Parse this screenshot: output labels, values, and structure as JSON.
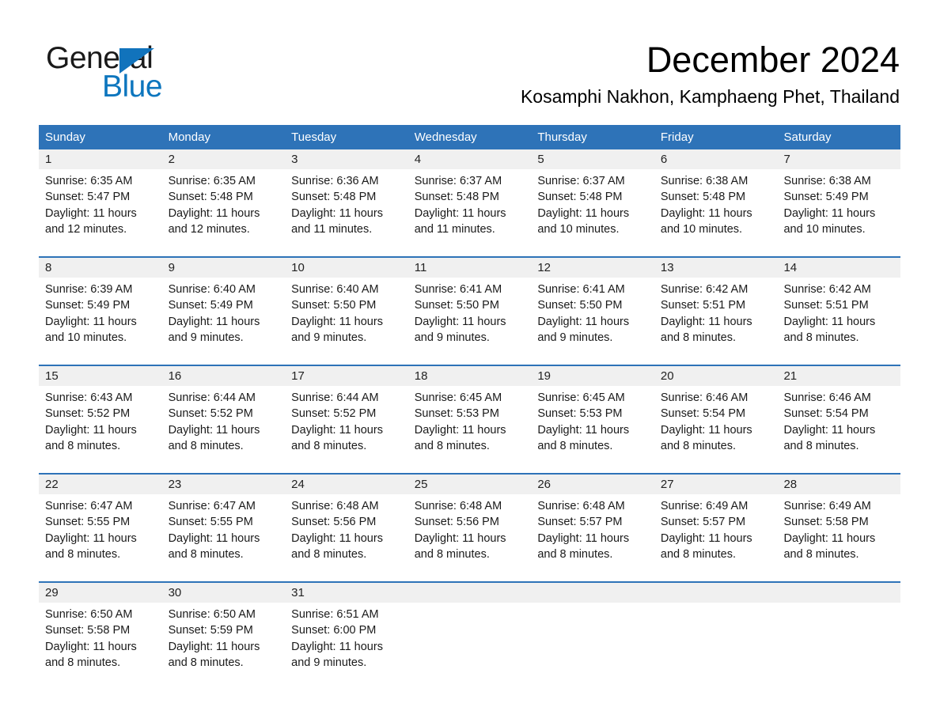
{
  "brand": {
    "name_part1": "General",
    "name_part2": "Blue",
    "triangle_color": "#1173BC",
    "blue_color": "#0D76BE"
  },
  "header": {
    "title": "December 2024",
    "location": "Kosamphi Nakhon, Kamphaeng Phet, Thailand"
  },
  "theme": {
    "header_blue": "#2E73B8",
    "daynum_band": "#F0F0F0",
    "text": "#1a1a1a"
  },
  "weekdays": [
    "Sunday",
    "Monday",
    "Tuesday",
    "Wednesday",
    "Thursday",
    "Friday",
    "Saturday"
  ],
  "weeks": [
    {
      "days": [
        {
          "num": "1",
          "sunrise": "Sunrise: 6:35 AM",
          "sunset": "Sunset: 5:47 PM",
          "daylight_1": "Daylight: 11 hours",
          "daylight_2": "and 12 minutes."
        },
        {
          "num": "2",
          "sunrise": "Sunrise: 6:35 AM",
          "sunset": "Sunset: 5:48 PM",
          "daylight_1": "Daylight: 11 hours",
          "daylight_2": "and 12 minutes."
        },
        {
          "num": "3",
          "sunrise": "Sunrise: 6:36 AM",
          "sunset": "Sunset: 5:48 PM",
          "daylight_1": "Daylight: 11 hours",
          "daylight_2": "and 11 minutes."
        },
        {
          "num": "4",
          "sunrise": "Sunrise: 6:37 AM",
          "sunset": "Sunset: 5:48 PM",
          "daylight_1": "Daylight: 11 hours",
          "daylight_2": "and 11 minutes."
        },
        {
          "num": "5",
          "sunrise": "Sunrise: 6:37 AM",
          "sunset": "Sunset: 5:48 PM",
          "daylight_1": "Daylight: 11 hours",
          "daylight_2": "and 10 minutes."
        },
        {
          "num": "6",
          "sunrise": "Sunrise: 6:38 AM",
          "sunset": "Sunset: 5:48 PM",
          "daylight_1": "Daylight: 11 hours",
          "daylight_2": "and 10 minutes."
        },
        {
          "num": "7",
          "sunrise": "Sunrise: 6:38 AM",
          "sunset": "Sunset: 5:49 PM",
          "daylight_1": "Daylight: 11 hours",
          "daylight_2": "and 10 minutes."
        }
      ]
    },
    {
      "days": [
        {
          "num": "8",
          "sunrise": "Sunrise: 6:39 AM",
          "sunset": "Sunset: 5:49 PM",
          "daylight_1": "Daylight: 11 hours",
          "daylight_2": "and 10 minutes."
        },
        {
          "num": "9",
          "sunrise": "Sunrise: 6:40 AM",
          "sunset": "Sunset: 5:49 PM",
          "daylight_1": "Daylight: 11 hours",
          "daylight_2": "and 9 minutes."
        },
        {
          "num": "10",
          "sunrise": "Sunrise: 6:40 AM",
          "sunset": "Sunset: 5:50 PM",
          "daylight_1": "Daylight: 11 hours",
          "daylight_2": "and 9 minutes."
        },
        {
          "num": "11",
          "sunrise": "Sunrise: 6:41 AM",
          "sunset": "Sunset: 5:50 PM",
          "daylight_1": "Daylight: 11 hours",
          "daylight_2": "and 9 minutes."
        },
        {
          "num": "12",
          "sunrise": "Sunrise: 6:41 AM",
          "sunset": "Sunset: 5:50 PM",
          "daylight_1": "Daylight: 11 hours",
          "daylight_2": "and 9 minutes."
        },
        {
          "num": "13",
          "sunrise": "Sunrise: 6:42 AM",
          "sunset": "Sunset: 5:51 PM",
          "daylight_1": "Daylight: 11 hours",
          "daylight_2": "and 8 minutes."
        },
        {
          "num": "14",
          "sunrise": "Sunrise: 6:42 AM",
          "sunset": "Sunset: 5:51 PM",
          "daylight_1": "Daylight: 11 hours",
          "daylight_2": "and 8 minutes."
        }
      ]
    },
    {
      "days": [
        {
          "num": "15",
          "sunrise": "Sunrise: 6:43 AM",
          "sunset": "Sunset: 5:52 PM",
          "daylight_1": "Daylight: 11 hours",
          "daylight_2": "and 8 minutes."
        },
        {
          "num": "16",
          "sunrise": "Sunrise: 6:44 AM",
          "sunset": "Sunset: 5:52 PM",
          "daylight_1": "Daylight: 11 hours",
          "daylight_2": "and 8 minutes."
        },
        {
          "num": "17",
          "sunrise": "Sunrise: 6:44 AM",
          "sunset": "Sunset: 5:52 PM",
          "daylight_1": "Daylight: 11 hours",
          "daylight_2": "and 8 minutes."
        },
        {
          "num": "18",
          "sunrise": "Sunrise: 6:45 AM",
          "sunset": "Sunset: 5:53 PM",
          "daylight_1": "Daylight: 11 hours",
          "daylight_2": "and 8 minutes."
        },
        {
          "num": "19",
          "sunrise": "Sunrise: 6:45 AM",
          "sunset": "Sunset: 5:53 PM",
          "daylight_1": "Daylight: 11 hours",
          "daylight_2": "and 8 minutes."
        },
        {
          "num": "20",
          "sunrise": "Sunrise: 6:46 AM",
          "sunset": "Sunset: 5:54 PM",
          "daylight_1": "Daylight: 11 hours",
          "daylight_2": "and 8 minutes."
        },
        {
          "num": "21",
          "sunrise": "Sunrise: 6:46 AM",
          "sunset": "Sunset: 5:54 PM",
          "daylight_1": "Daylight: 11 hours",
          "daylight_2": "and 8 minutes."
        }
      ]
    },
    {
      "days": [
        {
          "num": "22",
          "sunrise": "Sunrise: 6:47 AM",
          "sunset": "Sunset: 5:55 PM",
          "daylight_1": "Daylight: 11 hours",
          "daylight_2": "and 8 minutes."
        },
        {
          "num": "23",
          "sunrise": "Sunrise: 6:47 AM",
          "sunset": "Sunset: 5:55 PM",
          "daylight_1": "Daylight: 11 hours",
          "daylight_2": "and 8 minutes."
        },
        {
          "num": "24",
          "sunrise": "Sunrise: 6:48 AM",
          "sunset": "Sunset: 5:56 PM",
          "daylight_1": "Daylight: 11 hours",
          "daylight_2": "and 8 minutes."
        },
        {
          "num": "25",
          "sunrise": "Sunrise: 6:48 AM",
          "sunset": "Sunset: 5:56 PM",
          "daylight_1": "Daylight: 11 hours",
          "daylight_2": "and 8 minutes."
        },
        {
          "num": "26",
          "sunrise": "Sunrise: 6:48 AM",
          "sunset": "Sunset: 5:57 PM",
          "daylight_1": "Daylight: 11 hours",
          "daylight_2": "and 8 minutes."
        },
        {
          "num": "27",
          "sunrise": "Sunrise: 6:49 AM",
          "sunset": "Sunset: 5:57 PM",
          "daylight_1": "Daylight: 11 hours",
          "daylight_2": "and 8 minutes."
        },
        {
          "num": "28",
          "sunrise": "Sunrise: 6:49 AM",
          "sunset": "Sunset: 5:58 PM",
          "daylight_1": "Daylight: 11 hours",
          "daylight_2": "and 8 minutes."
        }
      ]
    },
    {
      "days": [
        {
          "num": "29",
          "sunrise": "Sunrise: 6:50 AM",
          "sunset": "Sunset: 5:58 PM",
          "daylight_1": "Daylight: 11 hours",
          "daylight_2": "and 8 minutes."
        },
        {
          "num": "30",
          "sunrise": "Sunrise: 6:50 AM",
          "sunset": "Sunset: 5:59 PM",
          "daylight_1": "Daylight: 11 hours",
          "daylight_2": "and 8 minutes."
        },
        {
          "num": "31",
          "sunrise": "Sunrise: 6:51 AM",
          "sunset": "Sunset: 6:00 PM",
          "daylight_1": "Daylight: 11 hours",
          "daylight_2": "and 9 minutes."
        },
        {
          "num": "",
          "sunrise": "",
          "sunset": "",
          "daylight_1": "",
          "daylight_2": ""
        },
        {
          "num": "",
          "sunrise": "",
          "sunset": "",
          "daylight_1": "",
          "daylight_2": ""
        },
        {
          "num": "",
          "sunrise": "",
          "sunset": "",
          "daylight_1": "",
          "daylight_2": ""
        },
        {
          "num": "",
          "sunrise": "",
          "sunset": "",
          "daylight_1": "",
          "daylight_2": ""
        }
      ]
    }
  ]
}
